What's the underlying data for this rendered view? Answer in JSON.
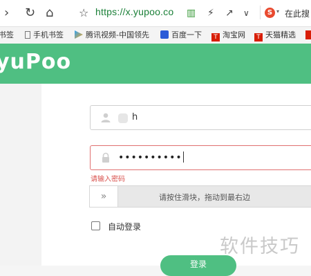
{
  "browser": {
    "url": "https://x.yupoo.co",
    "search_label": "在此搜"
  },
  "bookmarks": [
    {
      "label": "书签"
    },
    {
      "label": "手机书签"
    },
    {
      "label": "腾讯视频-中国领先"
    },
    {
      "label": "百度一下"
    },
    {
      "label": "淘宝网"
    },
    {
      "label": "天猫精选"
    }
  ],
  "brand": {
    "logo_text": "yuPoo",
    "color": "#4fbf82"
  },
  "form": {
    "username_value": "h",
    "password_value": "••••••••••",
    "error_message": "请输入密码",
    "slider_text": "请按住滑块，拖动到最右边",
    "slider_handle": "»",
    "remember_label": "自动登录",
    "remember_checked": false,
    "login_label": "登录"
  },
  "watermark": "软件技巧"
}
